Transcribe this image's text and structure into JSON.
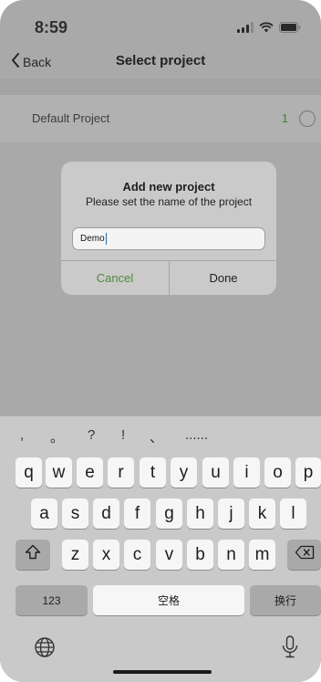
{
  "status": {
    "time": "8:59"
  },
  "nav": {
    "back_label": "Back",
    "title": "Select project"
  },
  "list": {
    "items": [
      {
        "label": "Default Project",
        "count": "1"
      }
    ]
  },
  "dialog": {
    "title": "Add new project",
    "message": "Please set the name of the project",
    "input_value": "Demo",
    "cancel_label": "Cancel",
    "done_label": "Done"
  },
  "keyboard": {
    "candidates": [
      ",",
      "。",
      "?",
      "!",
      "、",
      "......"
    ],
    "row1": [
      "q",
      "w",
      "e",
      "r",
      "t",
      "y",
      "u",
      "i",
      "o",
      "p"
    ],
    "row2": [
      "a",
      "s",
      "d",
      "f",
      "g",
      "h",
      "j",
      "k",
      "l"
    ],
    "row3": [
      "z",
      "x",
      "c",
      "v",
      "b",
      "n",
      "m"
    ],
    "numbers_label": "123",
    "space_label": "空格",
    "return_label": "换行",
    "shift_icon": "shift-icon",
    "delete_icon": "delete-icon",
    "globe_icon": "globe-icon",
    "mic_icon": "microphone-icon"
  },
  "colors": {
    "accent_green": "#4f8a3c",
    "caret_blue": "#2f6bd8"
  }
}
